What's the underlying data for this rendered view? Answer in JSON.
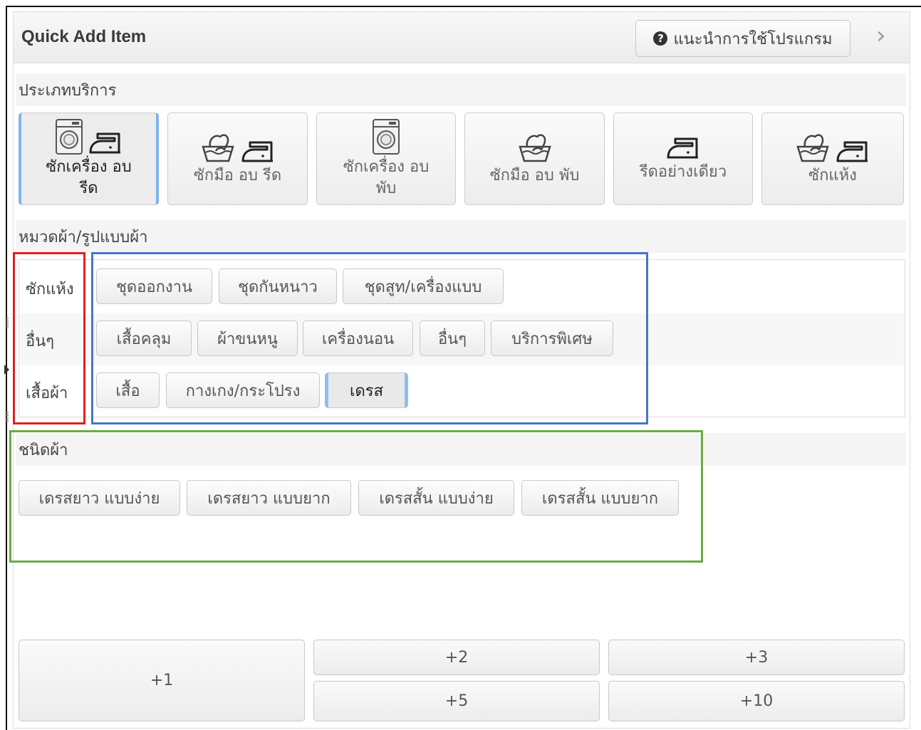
{
  "header": {
    "title": "Quick Add Item",
    "help_label": "แนะนำการใช้โปรแกรม"
  },
  "service_section": {
    "label": "ประเภทบริการ",
    "items": [
      {
        "line1": "ซักเครื่อง อบ",
        "line2": "รีด",
        "icons": [
          "washing-machine-icon",
          "iron-icon"
        ],
        "active": true
      },
      {
        "line1": "ซักมือ อบ รีด",
        "line2": "",
        "icons": [
          "hand-wash-icon",
          "iron-icon"
        ],
        "active": false
      },
      {
        "line1": "ซักเครื่อง อบ",
        "line2": "พับ",
        "icons": [
          "washing-machine-icon"
        ],
        "active": false
      },
      {
        "line1": "ซักมือ อบ พับ",
        "line2": "",
        "icons": [
          "hand-wash-icon"
        ],
        "active": false
      },
      {
        "line1": "รีดอย่างเดียว",
        "line2": "",
        "icons": [
          "iron-icon"
        ],
        "active": false
      },
      {
        "line1": "ซักแห้ง",
        "line2": "",
        "icons": [
          "hand-wash-icon",
          "iron-icon"
        ],
        "active": false
      }
    ]
  },
  "category_section": {
    "label": "หมวดผ้า/รูปแบบผ้า",
    "rows": [
      {
        "name": "ซักแห้ง",
        "items": [
          "ชุดออกงาน",
          "ชุดกันหนาว",
          "ชุดสูท/เครื่องแบบ"
        ]
      },
      {
        "name": "อื่นๆ",
        "items": [
          "เสื้อคลุม",
          "ผ้าขนหนู",
          "เครื่องนอน",
          "อื่นๆ",
          "บริการพิเศษ"
        ]
      },
      {
        "name": "เสื้อผ้า",
        "items": [
          "เสื้อ",
          "กางเกง/กระโปรง",
          "เดรส"
        ],
        "active_item": "เดรส"
      }
    ]
  },
  "fabric_section": {
    "label": "ชนิดผ้า",
    "items": [
      "เดรสยาว แบบง่าย",
      "เดรสยาว แบบยาก",
      "เดรสสั้น แบบง่าย",
      "เดรสสั้น แบบยาก"
    ]
  },
  "quantity_buttons": [
    "+1",
    "+2",
    "+3",
    "+5",
    "+10"
  ],
  "colors": {
    "accent": "#8fbdf0",
    "annotation_red": "#e02020",
    "annotation_blue": "#4a74c9",
    "annotation_green": "#6aab45"
  }
}
